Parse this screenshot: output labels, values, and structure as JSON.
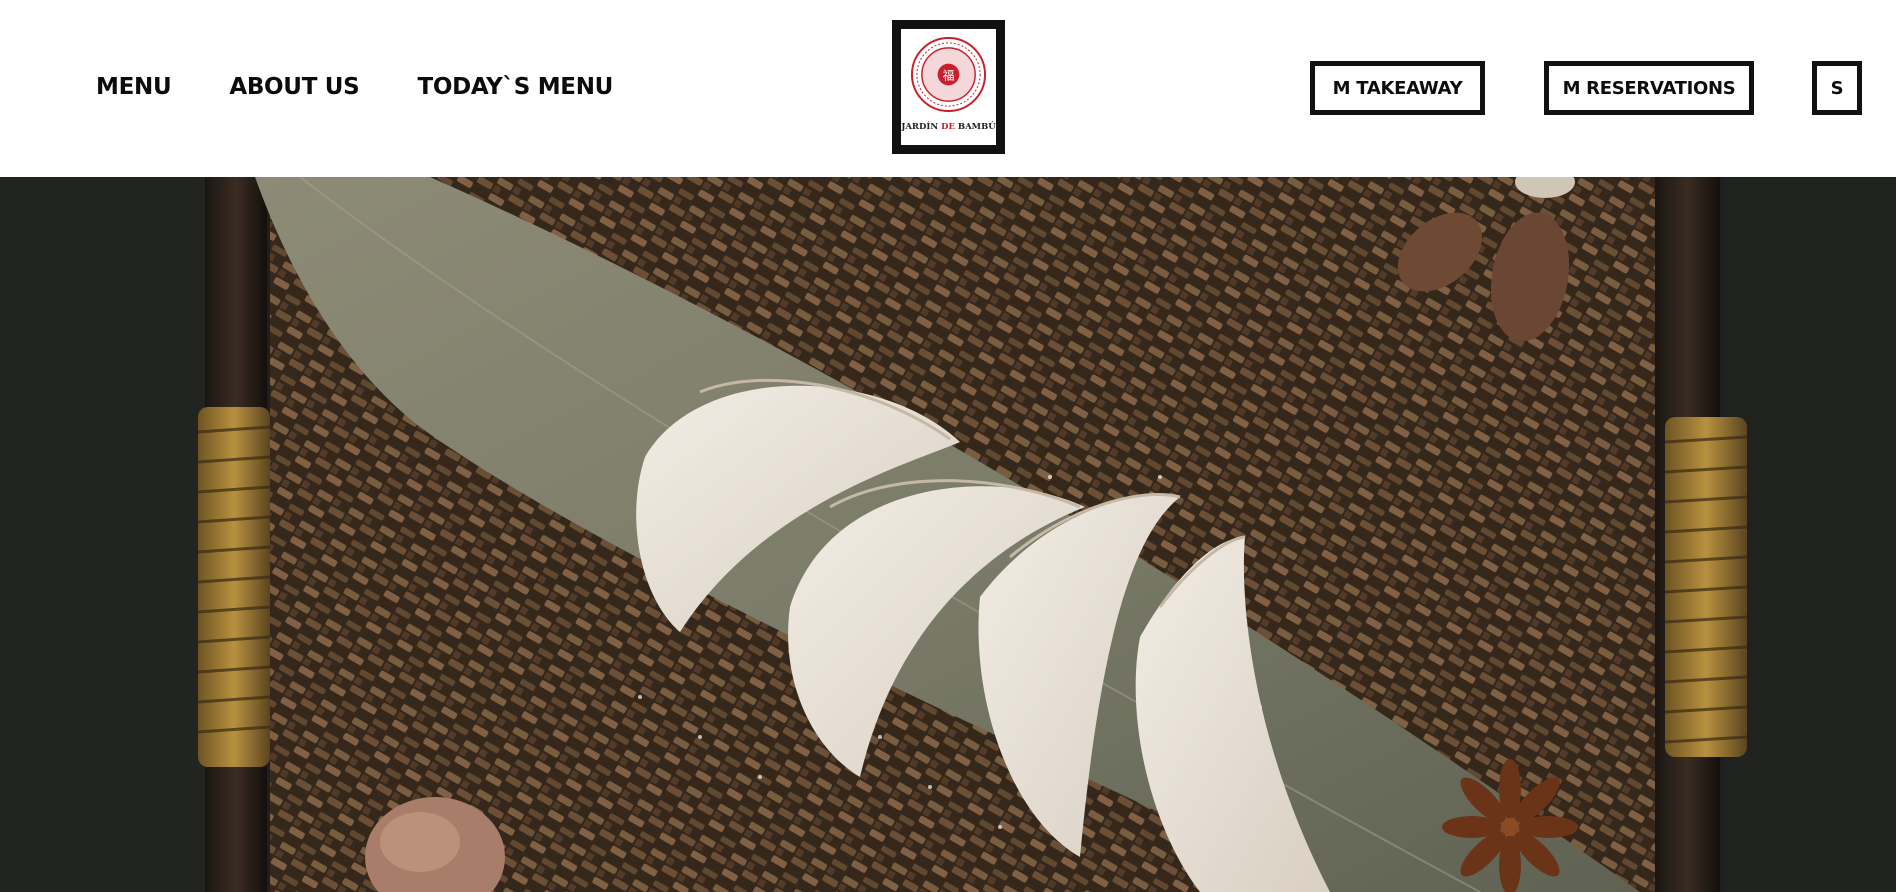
{
  "header": {
    "nav_left": [
      {
        "label": "MENU"
      },
      {
        "label": "ABOUT US"
      },
      {
        "label": "TODAY`S MENU"
      }
    ],
    "logo": {
      "name_part1": "JARDÍN ",
      "name_part2": "DE",
      "name_part3": " BAMBÚ",
      "seal_glyph": "福"
    },
    "nav_right": {
      "takeaway_label": "M TAKEAWAY",
      "reservations_label": "M RESERVATIONS",
      "s_label": "S"
    }
  },
  "hero": {
    "subject": "steamed dumplings on bamboo leaf over woven tray"
  },
  "colors": {
    "brand_red": "#c8202c",
    "text_dark": "#0c0c0c",
    "border": "#111111"
  }
}
